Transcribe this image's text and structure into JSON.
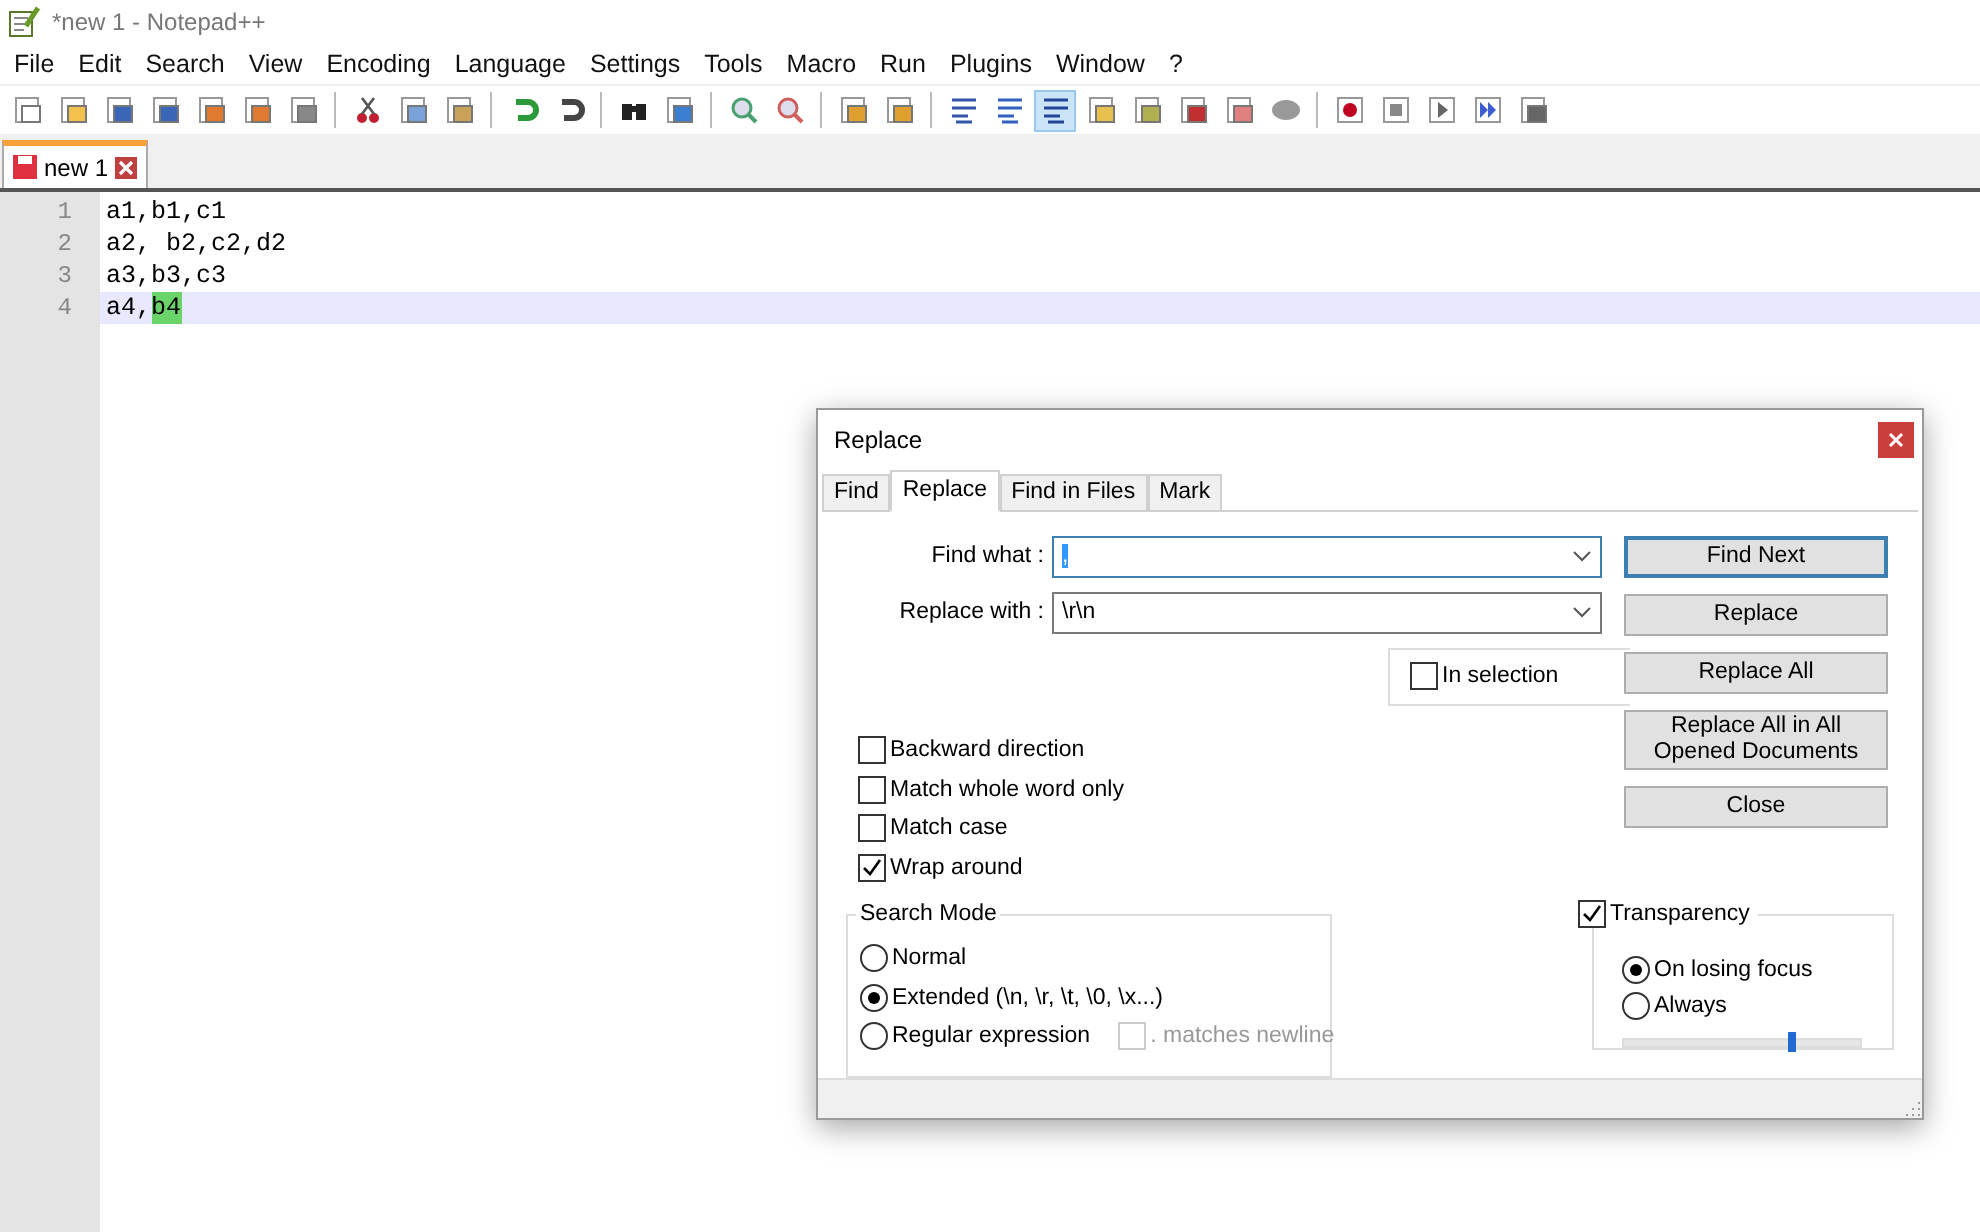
{
  "window": {
    "title": "*new 1 - Notepad++"
  },
  "menu": [
    "File",
    "Edit",
    "Search",
    "View",
    "Encoding",
    "Language",
    "Settings",
    "Tools",
    "Macro",
    "Run",
    "Plugins",
    "Window",
    "?"
  ],
  "toolbar": [
    {
      "kind": "new",
      "pressed": false
    },
    {
      "kind": "open",
      "pressed": false
    },
    {
      "kind": "save",
      "pressed": false
    },
    {
      "kind": "saveall",
      "pressed": false
    },
    {
      "kind": "close",
      "pressed": false
    },
    {
      "kind": "closeall",
      "pressed": false
    },
    {
      "kind": "print",
      "pressed": false
    },
    {
      "kind": "sep"
    },
    {
      "kind": "cut",
      "pressed": false
    },
    {
      "kind": "copy",
      "pressed": false
    },
    {
      "kind": "paste",
      "pressed": false
    },
    {
      "kind": "sep"
    },
    {
      "kind": "undo",
      "pressed": false
    },
    {
      "kind": "redo",
      "pressed": false
    },
    {
      "kind": "sep"
    },
    {
      "kind": "find",
      "pressed": false
    },
    {
      "kind": "replace",
      "pressed": false
    },
    {
      "kind": "sep"
    },
    {
      "kind": "zoomin",
      "pressed": false
    },
    {
      "kind": "zoomout",
      "pressed": false
    },
    {
      "kind": "sep"
    },
    {
      "kind": "sync",
      "pressed": false
    },
    {
      "kind": "sync",
      "pressed": false
    },
    {
      "kind": "sep"
    },
    {
      "kind": "wrap",
      "pressed": false
    },
    {
      "kind": "allchars",
      "pressed": false
    },
    {
      "kind": "indent",
      "pressed": true
    },
    {
      "kind": "panel",
      "pressed": false
    },
    {
      "kind": "map",
      "pressed": false
    },
    {
      "kind": "func",
      "pressed": false
    },
    {
      "kind": "folder",
      "pressed": false
    },
    {
      "kind": "blob",
      "pressed": false
    },
    {
      "kind": "sep"
    },
    {
      "kind": "record",
      "pressed": false
    },
    {
      "kind": "stop",
      "pressed": false
    },
    {
      "kind": "play",
      "pressed": false
    },
    {
      "kind": "playmulti",
      "pressed": false
    },
    {
      "kind": "savemacro",
      "pressed": false
    }
  ],
  "tabs": [
    {
      "label": "new 1",
      "selected": true,
      "modified": true
    }
  ],
  "editor": {
    "lines": [
      {
        "number": "1",
        "current": false,
        "segments": [
          {
            "text": "a1,b1,c1",
            "highlighted": false
          }
        ]
      },
      {
        "number": "2",
        "current": false,
        "segments": [
          {
            "text": "a2, b2,c2,d2",
            "highlighted": false
          }
        ]
      },
      {
        "number": "3",
        "current": false,
        "segments": [
          {
            "text": "a3,b3,c3",
            "highlighted": false
          }
        ]
      },
      {
        "number": "4",
        "current": true,
        "segments": [
          {
            "text": "a4,",
            "highlighted": false
          },
          {
            "text": "b4",
            "highlighted": true
          }
        ]
      }
    ]
  },
  "dialog": {
    "title": "Replace",
    "tabs": [
      {
        "label": "Find",
        "selected": false
      },
      {
        "label": "Replace",
        "selected": true
      },
      {
        "label": "Find in Files",
        "selected": false
      },
      {
        "label": "Mark",
        "selected": false
      }
    ],
    "fields": [
      {
        "label": "Find what :",
        "value": ",",
        "focused": true
      },
      {
        "label": "Replace with :",
        "value": "\\r\\n",
        "focused": false
      }
    ],
    "in_selection": {
      "label": "In selection",
      "checked": false
    },
    "buttons": [
      {
        "label": "Find Next",
        "default": true
      },
      {
        "label": "Replace",
        "default": false
      },
      {
        "label": "Replace All",
        "default": false
      },
      {
        "label": "Replace All in All Opened Documents",
        "default": false
      },
      {
        "label": "Close",
        "default": false
      }
    ],
    "options": [
      {
        "label": "Backward direction",
        "checked": false
      },
      {
        "label": "Match whole word only",
        "checked": false
      },
      {
        "label": "Match case",
        "checked": false
      },
      {
        "label": "Wrap around",
        "checked": true
      }
    ],
    "search_mode": {
      "title": "Search Mode",
      "modes": [
        {
          "label": "Normal",
          "selected": false
        },
        {
          "label": "Extended (\\n, \\r, \\t, \\0, \\x...)",
          "selected": true
        },
        {
          "label": "Regular expression",
          "selected": false
        }
      ],
      "dot_newline": {
        "label": ". matches newline",
        "checked": false,
        "disabled": true
      }
    },
    "transparency": {
      "label": "Transparency",
      "checked": true,
      "modes": [
        {
          "label": "On losing focus",
          "selected": true
        },
        {
          "label": "Always",
          "selected": false
        }
      ],
      "level": 0.71
    }
  }
}
